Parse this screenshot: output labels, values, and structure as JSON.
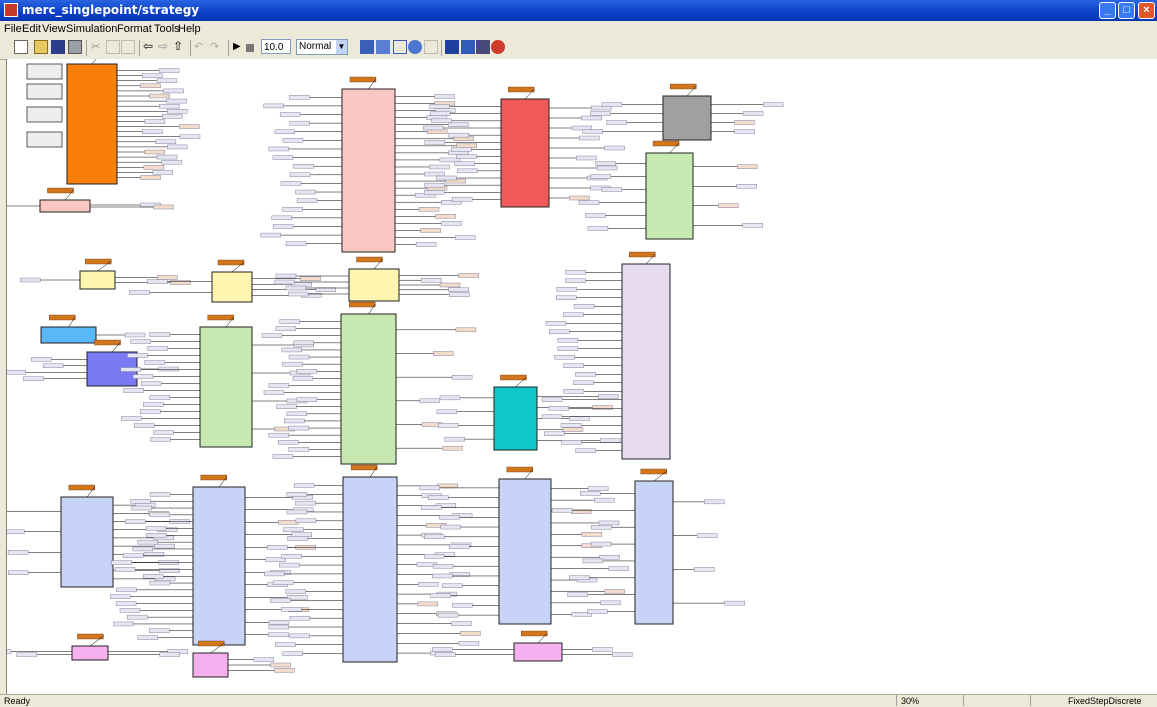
{
  "window": {
    "title": "merc_singlepoint/strategy"
  },
  "menu": [
    "File",
    "Edit",
    "View",
    "Simulation",
    "Format",
    "Tools",
    "Help"
  ],
  "toolbar": {
    "stop_time": "10.0",
    "sim_mode": "Normal"
  },
  "status": {
    "left": "Ready",
    "zoom": "30%",
    "solver": "FixedStepDiscrete"
  },
  "colors": {
    "orange": "#f77f0a",
    "pink": "#fbc7c3",
    "red": "#f25a5a",
    "gray": "#a0a0a0",
    "green": "#c7e8b0",
    "yellow": "#fdf5b0",
    "cyan": "#10c6c6",
    "purple": "#e7dcf2",
    "blue": "#c7d3f7",
    "violet": "#7a7af5",
    "sky": "#59b8f5",
    "magenta": "#f5b0f0",
    "tag": "#d2761e"
  }
}
